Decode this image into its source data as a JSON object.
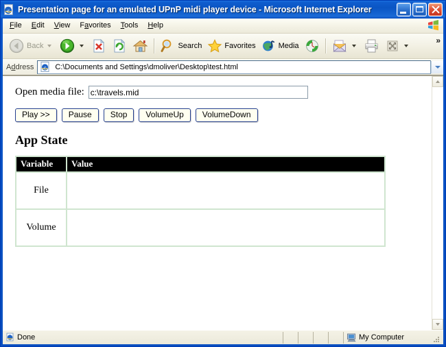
{
  "window": {
    "title": "Presentation page for an emulated UPnP midi player device - Microsoft Internet Explorer",
    "icon": "ie-document-icon",
    "caption_buttons": {
      "minimize": "Minimize",
      "maximize": "Maximize",
      "close": "Close"
    }
  },
  "menubar": {
    "items": [
      {
        "label": "File",
        "pre": "F",
        "key": "i",
        "post": "le"
      },
      {
        "label": "Edit",
        "pre": "E",
        "key": "d",
        "post": "it"
      },
      {
        "label": "View",
        "pre": "",
        "key": "V",
        "post": "iew"
      },
      {
        "label": "Favorites",
        "pre": "F",
        "key": "a",
        "post": "vorites"
      },
      {
        "label": "Tools",
        "pre": "",
        "key": "T",
        "post": "ools"
      },
      {
        "label": "Help",
        "pre": "",
        "key": "H",
        "post": "elp"
      }
    ],
    "brand_icon": "windows-flag-icon"
  },
  "toolbar": {
    "back": {
      "label": "Back",
      "icon": "back-arrow-icon",
      "disabled": true
    },
    "forward": {
      "label": "",
      "icon": "forward-arrow-icon",
      "disabled": false
    },
    "stop": {
      "label": "",
      "icon": "stop-icon"
    },
    "refresh": {
      "label": "",
      "icon": "refresh-icon"
    },
    "home": {
      "label": "",
      "icon": "home-icon"
    },
    "search": {
      "label": "Search",
      "icon": "search-icon"
    },
    "favorites": {
      "label": "Favorites",
      "icon": "star-icon"
    },
    "media": {
      "label": "Media",
      "icon": "media-icon"
    },
    "history": {
      "label": "",
      "icon": "history-icon"
    },
    "mail": {
      "label": "",
      "icon": "mail-icon"
    },
    "print": {
      "label": "",
      "icon": "print-icon"
    },
    "edit": {
      "label": "",
      "icon": "edit-page-icon"
    },
    "overflow": "»"
  },
  "address": {
    "label_pre": "A",
    "label_key": "d",
    "label_post": "dress",
    "icon": "page-icon",
    "value": "C:\\Documents and Settings\\dmoliver\\Desktop\\test.html",
    "dropdown_icon": "chevron-down-icon"
  },
  "document": {
    "form": {
      "label": "Open media file:",
      "input_value": "c:\\travels.mid",
      "input_placeholder": ""
    },
    "buttons": [
      {
        "label": "Play >>",
        "name": "play-button"
      },
      {
        "label": "Pause",
        "name": "pause-button"
      },
      {
        "label": "Stop",
        "name": "stop-button"
      },
      {
        "label": "VolumeUp",
        "name": "volume-up-button"
      },
      {
        "label": "VolumeDown",
        "name": "volume-down-button"
      }
    ],
    "heading": "App State",
    "table": {
      "columns": [
        "Variable",
        "Value"
      ],
      "rows": [
        {
          "variable": "File",
          "value": ""
        },
        {
          "variable": "Volume",
          "value": ""
        }
      ]
    }
  },
  "statusbar": {
    "message": "Done",
    "message_icon": "ie-page-icon",
    "zone": "My Computer",
    "zone_icon": "my-computer-icon"
  },
  "colors": {
    "title_blue": "#0a55c4",
    "close_red": "#c5301a",
    "chrome": "#ece9d8",
    "table_header_bg": "#000000",
    "table_border_green": "#cfe5cf",
    "button_face": "#fffff0",
    "button_border": "#243f8f"
  }
}
